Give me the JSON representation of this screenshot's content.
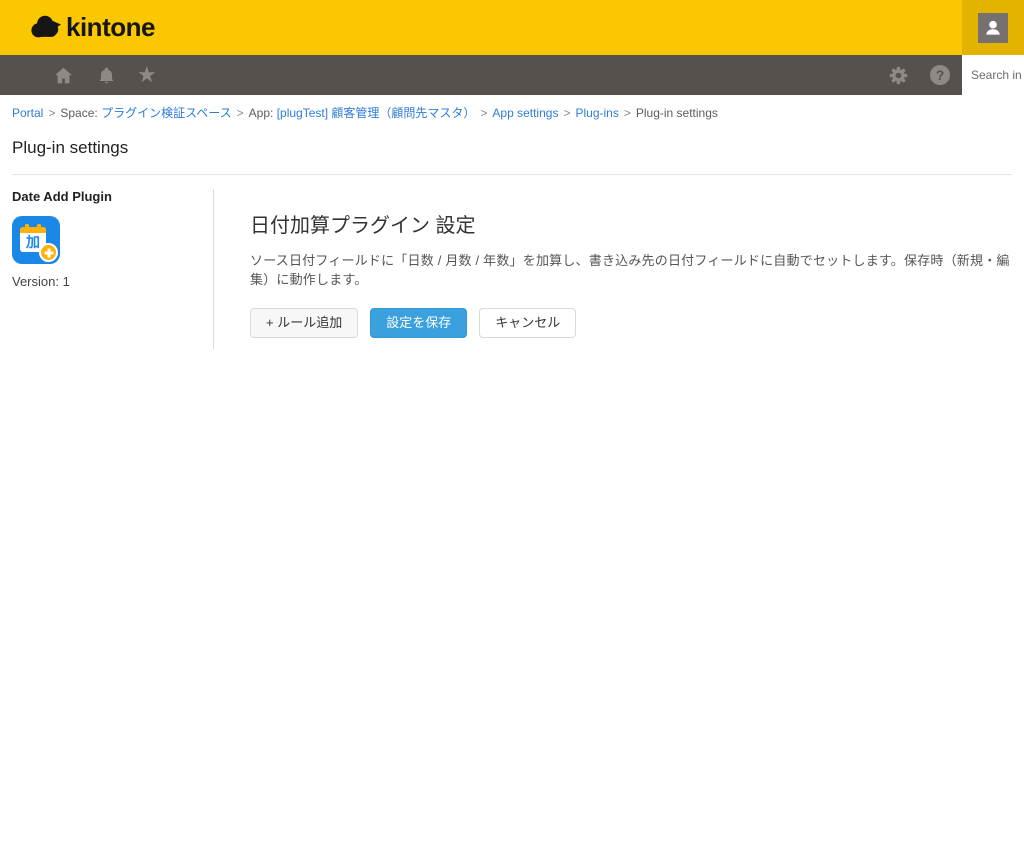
{
  "header": {
    "logo_text": "kintone",
    "search_value": "Search in"
  },
  "icons": {
    "star_glyph": "★",
    "help_glyph": "?"
  },
  "breadcrumb": {
    "separator": ">",
    "items": [
      {
        "label": "Portal"
      },
      {
        "prefix": "Space: ",
        "label": "プラグイン検証スペース"
      },
      {
        "prefix": "App: ",
        "label": "[plugTest] 顧客管理（顧問先マスタ）"
      },
      {
        "label": "App settings"
      },
      {
        "label": "Plug-ins"
      },
      {
        "label": "Plug-in settings"
      }
    ]
  },
  "page": {
    "title": "Plug-in settings"
  },
  "sidebar": {
    "plugin_name": "Date Add Plugin",
    "icon_char": "加",
    "version": "Version: 1"
  },
  "main": {
    "heading": "日付加算プラグイン 設定",
    "description": "ソース日付フィールドに「日数 / 月数 / 年数」を加算し、書き込み先の日付フィールドに自動でセットします。保存時（新規・編集）に動作します。",
    "buttons": {
      "add_rule": "+ ルール追加",
      "save": "設定を保存",
      "cancel": "キャンセル"
    }
  },
  "colors": {
    "brand_yellow": "#FBC700",
    "brand_yellow_dark": "#E2B400",
    "navbar_gray": "#56514C",
    "icon_gray": "#8D8984",
    "link_blue": "#2E7CD9",
    "primary_button_blue": "#3BA0DE",
    "plugin_icon_blue": "#1B87E6",
    "plugin_icon_orange": "#FFB300"
  }
}
